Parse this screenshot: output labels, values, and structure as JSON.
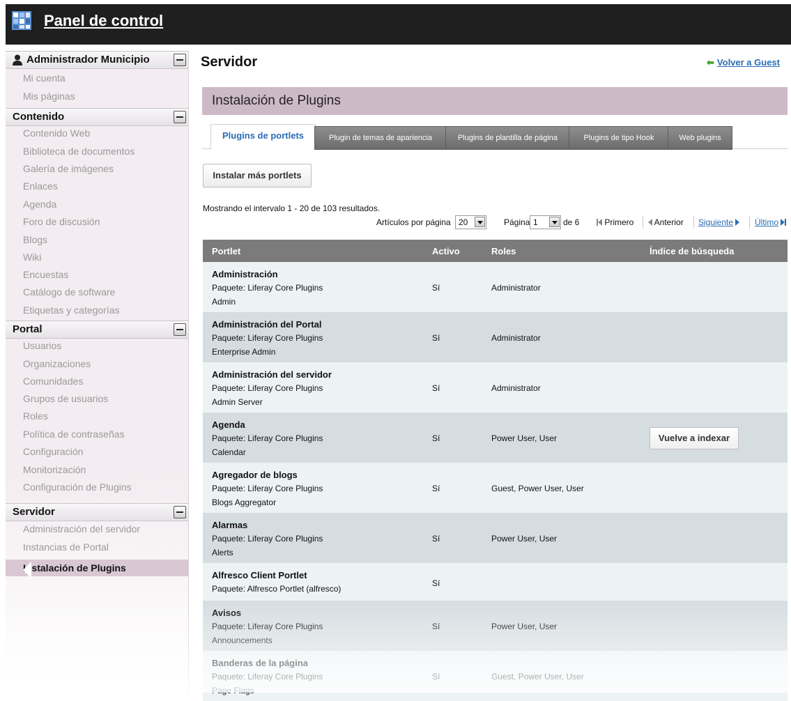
{
  "app": {
    "title": "Panel de control"
  },
  "sidebar": {
    "sections": [
      {
        "title": "Administrador Municipio",
        "items": [
          "Mi cuenta",
          "Mis páginas"
        ]
      },
      {
        "title": "Contenido",
        "items": [
          "Contenido Web",
          "Biblioteca de documentos",
          "Galería de imágenes",
          "Enlaces",
          "Agenda",
          "Foro de discusión",
          "Blogs",
          "Wiki",
          "Encuestas",
          "Catálogo de software",
          "Etiquetas y categorías"
        ]
      },
      {
        "title": "Portal",
        "items": [
          "Usuarios",
          "Organizaciones",
          "Comunidades",
          "Grupos de usuarios",
          "Roles",
          "Política de contraseñas",
          "Configuración",
          "Monitorización",
          "Configuración de Plugins"
        ]
      },
      {
        "title": "Servidor",
        "items": [
          "Administración del servidor",
          "Instancias de Portal",
          "Instalación de Plugins"
        ]
      }
    ]
  },
  "header": {
    "title": "Servidor",
    "back_link": "Volver a Guest"
  },
  "section": {
    "title": "Instalación de Plugins"
  },
  "tabs": [
    "Plugins de portlets",
    "Plugin de temas de apariencia",
    "Plugins de plantilla de página",
    "Plugins de tipo Hook",
    "Web plugins"
  ],
  "install_button": "Instalar más portlets",
  "results": "Mostrando el intervalo 1 - 20 de 103 resultados.",
  "pager": {
    "per_page_label": "Artículos por página",
    "per_page_value": "20",
    "page_label": "Página",
    "page_value": "1",
    "of_label": "de 6",
    "first": "Primero",
    "prev": "Anterior",
    "next": "Siguiente",
    "last": "Último"
  },
  "table": {
    "columns": [
      "Portlet",
      "Activo",
      "Roles",
      "Índice de búsqueda"
    ],
    "reindex_label": "Vuelve a indexar",
    "rows": [
      {
        "name": "Administración",
        "package": "Paquete: Liferay Core Plugins",
        "sub": "Admin",
        "active": "Sí",
        "roles": "Administrator"
      },
      {
        "name": "Administración del Portal",
        "package": "Paquete: Liferay Core Plugins",
        "sub": "Enterprise Admin",
        "active": "Sí",
        "roles": "Administrator"
      },
      {
        "name": "Administración del servidor",
        "package": "Paquete: Liferay Core Plugins",
        "sub": "Admin Server",
        "active": "Sí",
        "roles": "Administrator"
      },
      {
        "name": "Agenda",
        "package": "Paquete: Liferay Core Plugins",
        "sub": "Calendar",
        "active": "Sí",
        "roles": "Power User, User"
      },
      {
        "name": "Agregador de blogs",
        "package": "Paquete: Liferay Core Plugins",
        "sub": "Blogs Aggregator",
        "active": "Sí",
        "roles": "Guest, Power User, User"
      },
      {
        "name": "Alarmas",
        "package": "Paquete: Liferay Core Plugins",
        "sub": "Alerts",
        "active": "Sí",
        "roles": "Power User, User"
      },
      {
        "name": "Alfresco Client Portlet",
        "package": "Paquete: Alfresco Portlet (alfresco)",
        "sub": "",
        "active": "Sí",
        "roles": ""
      },
      {
        "name": "Avisos",
        "package": "Paquete: Liferay Core Plugins",
        "sub": "Announcements",
        "active": "Sí",
        "roles": "Power User, User"
      },
      {
        "name": "Banderas de la página",
        "package": "Paquete: Liferay Core Plugins",
        "sub": "Page Flags",
        "active": "Sí",
        "roles": "Guest, Power User, User"
      }
    ]
  }
}
